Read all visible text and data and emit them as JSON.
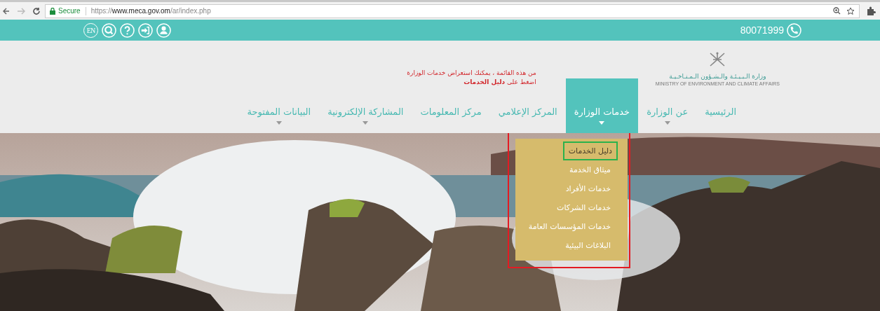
{
  "browser": {
    "secure_label": "Secure",
    "url_scheme": "https://",
    "url_host": "www.meca.gov.om",
    "url_path": "/ar/index.php"
  },
  "topbar": {
    "phone": "80071999",
    "icons": [
      {
        "kind": "language",
        "label": "EN"
      },
      {
        "kind": "search"
      },
      {
        "kind": "help"
      },
      {
        "kind": "login"
      },
      {
        "kind": "user"
      }
    ]
  },
  "logo": {
    "arabic": "وزارة الـبـيـئـة والـشـؤون الـمـنـاخـيـة",
    "english": "MINISTRY OF ENVIRONMENT AND CLIMATE AFFAIRS"
  },
  "note": {
    "line_1": "من هذه القائمة ، يمكنك استعراض خدمات الوزارة",
    "line_2": "اضغط على **دليل الخدمات**"
  },
  "nav": [
    {
      "label": "الرئيسية",
      "selected": false,
      "has_submenu": false
    },
    {
      "label": "عن الوزارة",
      "selected": false,
      "has_submenu": true
    },
    {
      "label": "خدمات الوزارة",
      "selected": true,
      "has_submenu": true
    },
    {
      "label": "المركز الإعلامي",
      "selected": false,
      "has_submenu": false
    },
    {
      "label": "مركز المعلومات",
      "selected": false,
      "has_submenu": false
    },
    {
      "label": "المشاركة الإلكترونية",
      "selected": false,
      "has_submenu": true
    },
    {
      "label": "البيانات المفتوحة",
      "selected": false,
      "has_submenu": true
    }
  ],
  "dropdown": {
    "highlighted": true,
    "items": [
      {
        "label": "دليل الخدمات",
        "selected": true
      },
      {
        "label": "ميثاق الخدمة",
        "selected": false
      },
      {
        "label": "خدمات الأفراد",
        "selected": false
      },
      {
        "label": "خدمات الشركات",
        "selected": false
      },
      {
        "label": "خدمات المؤسسات العامة",
        "selected": false
      },
      {
        "label": "البلاغات البيئية",
        "selected": false
      }
    ]
  }
}
